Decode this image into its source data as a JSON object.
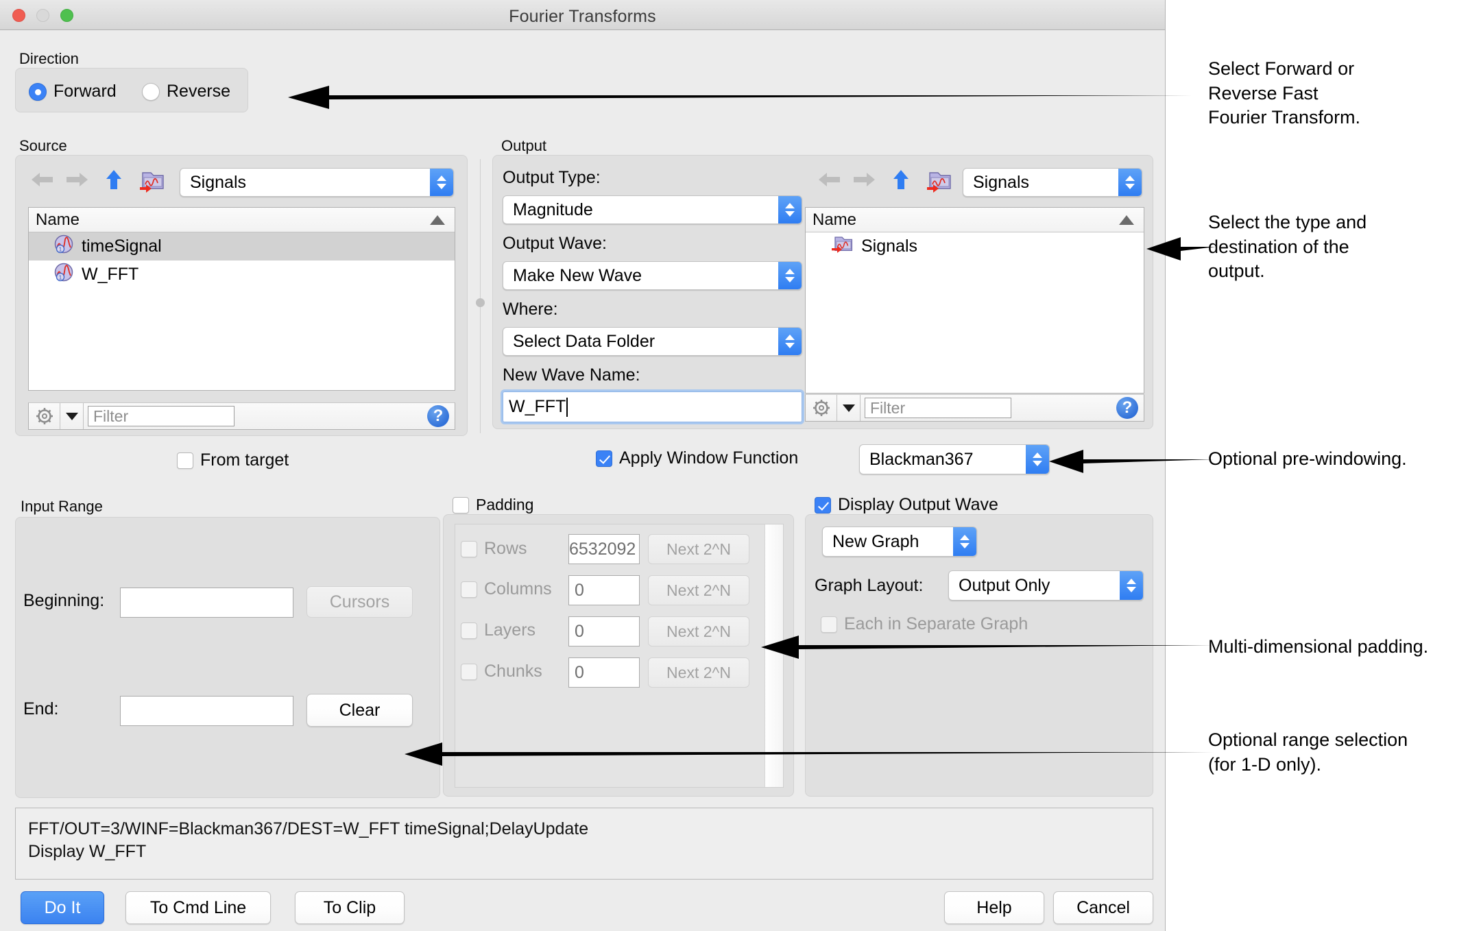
{
  "window": {
    "title": "Fourier Transforms",
    "traffic": [
      "close-button",
      "minimize-button",
      "maximize-button"
    ]
  },
  "direction": {
    "group_label": "Direction",
    "options": [
      {
        "label": "Forward",
        "selected": true
      },
      {
        "label": "Reverse",
        "selected": false
      }
    ]
  },
  "source": {
    "group_label": "Source",
    "path_value": "Signals",
    "column_header": "Name",
    "items": [
      {
        "label": "timeSignal",
        "icon": "wave-icon",
        "selected": true
      },
      {
        "label": "W_FFT",
        "icon": "wave-icon",
        "selected": false
      }
    ],
    "filter_placeholder": "Filter",
    "help_label": "?",
    "from_target_label": "From target",
    "from_target_checked": false
  },
  "output": {
    "group_label": "Output",
    "output_type_label": "Output Type:",
    "output_type_value": "Magnitude",
    "output_wave_label": "Output Wave:",
    "output_wave_value": "Make New Wave",
    "where_label": "Where:",
    "where_value": "Select Data Folder",
    "new_wave_name_label": "New Wave Name:",
    "new_wave_name_value": "W_FFT",
    "browser": {
      "path_value": "Signals",
      "column_header": "Name",
      "items": [
        {
          "label": "Signals",
          "icon": "data-folder-icon",
          "selected": false
        }
      ],
      "filter_placeholder": "Filter",
      "help_label": "?"
    }
  },
  "window_function": {
    "checkbox_label": "Apply Window Function",
    "checked": true,
    "value": "Blackman367"
  },
  "input_range": {
    "group_label": "Input Range",
    "beginning_label": "Beginning:",
    "beginning_value": "",
    "end_label": "End:",
    "end_value": "",
    "cursors_button": "Cursors",
    "cursors_enabled": false,
    "clear_button": "Clear",
    "clear_enabled": true
  },
  "padding": {
    "group_label": "Padding",
    "checked": false,
    "next_button_label": "Next 2^N",
    "rows": [
      {
        "label": "Rows",
        "checked": false,
        "value": "6532092",
        "enabled": false
      },
      {
        "label": "Columns",
        "checked": false,
        "value": "0",
        "enabled": false
      },
      {
        "label": "Layers",
        "checked": false,
        "value": "0",
        "enabled": false
      },
      {
        "label": "Chunks",
        "checked": false,
        "value": "0",
        "enabled": false
      }
    ]
  },
  "display_output": {
    "checkbox_label": "Display Output Wave",
    "checked": true,
    "target_value": "New Graph",
    "graph_layout_label": "Graph Layout:",
    "graph_layout_value": "Output Only",
    "each_separate_label": "Each in Separate Graph",
    "each_separate_checked": false,
    "each_separate_enabled": false
  },
  "command": {
    "line1": "FFT/OUT=3/WINF=Blackman367/DEST=W_FFT  timeSignal;DelayUpdate",
    "line2": "Display W_FFT"
  },
  "buttons": {
    "do_it": "Do It",
    "to_cmd_line": "To Cmd Line",
    "to_clip": "To Clip",
    "help": "Help",
    "cancel": "Cancel"
  },
  "annotations": [
    {
      "text": "Select Forward or\nReverse Fast\nFourier Transform."
    },
    {
      "text": "Select the type and\ndestination of the\noutput."
    },
    {
      "text": "Optional pre-windowing."
    },
    {
      "text": "Multi-dimensional padding."
    },
    {
      "text": "Optional range selection\n(for 1-D only)."
    }
  ],
  "colors": {
    "accent_blue": "#3b82f6",
    "window_bg": "#ececec",
    "group_bg": "#e0e0e0",
    "selection_gray": "#d2d2d2"
  }
}
